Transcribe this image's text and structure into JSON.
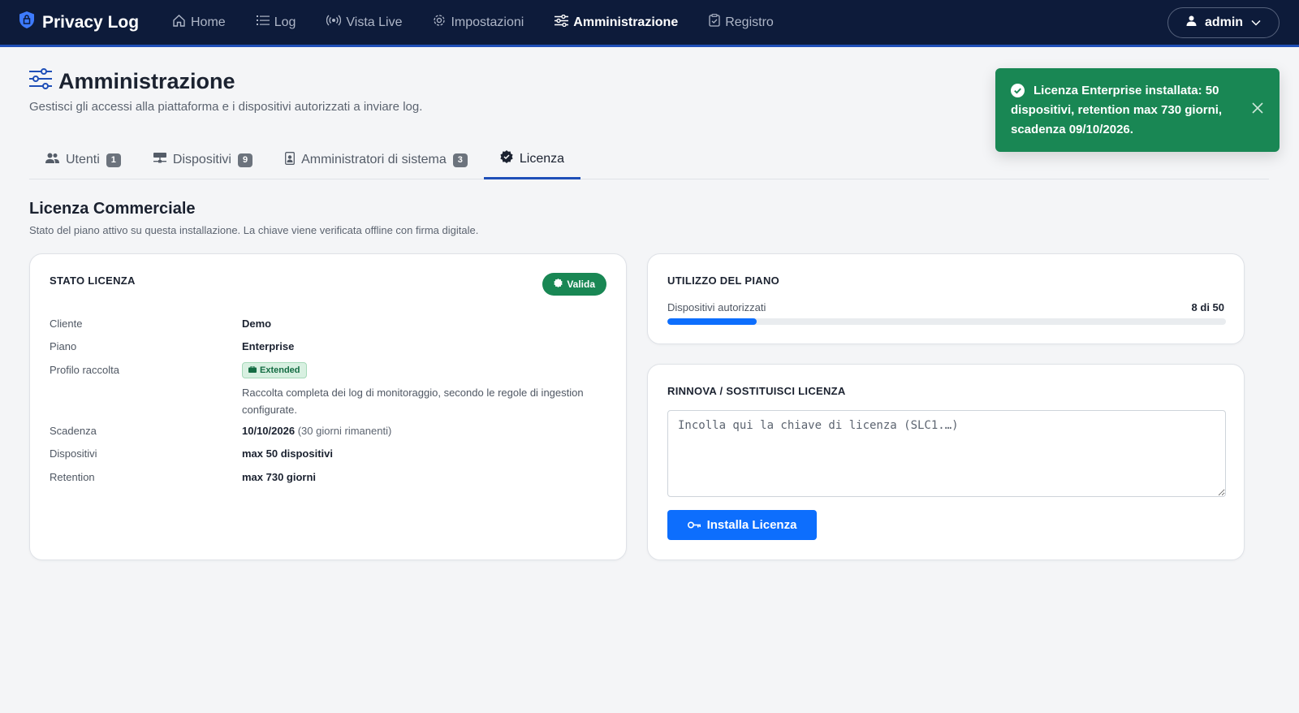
{
  "brand": {
    "name": "Privacy Log"
  },
  "nav": {
    "items": [
      {
        "label": "Home",
        "icon": "home-icon"
      },
      {
        "label": "Log",
        "icon": "list-icon"
      },
      {
        "label": "Vista Live",
        "icon": "broadcast-icon"
      },
      {
        "label": "Impostazioni",
        "icon": "gear-icon"
      },
      {
        "label": "Amministrazione",
        "icon": "sliders-icon",
        "active": true
      },
      {
        "label": "Registro",
        "icon": "clipboard-check-icon"
      }
    ],
    "user": "admin"
  },
  "page": {
    "title": "Amministrazione",
    "subtitle": "Gestisci gli accessi alla piattaforma e i dispositivi autorizzati a inviare log."
  },
  "tabs": [
    {
      "label": "Utenti",
      "count": "1",
      "icon": "people-icon"
    },
    {
      "label": "Dispositivi",
      "count": "9",
      "icon": "hdd-network-icon"
    },
    {
      "label": "Amministratori di sistema",
      "count": "3",
      "icon": "person-badge-icon"
    },
    {
      "label": "Licenza",
      "icon": "patch-check-icon",
      "active": true
    }
  ],
  "section": {
    "title": "Licenza Commerciale",
    "subtitle": "Stato del piano attivo su questa installazione. La chiave viene verificata offline con firma digitale."
  },
  "license_status": {
    "title": "STATO LICENZA",
    "badge": "Valida",
    "rows": {
      "cliente": {
        "label": "Cliente",
        "value": "Demo"
      },
      "piano": {
        "label": "Piano",
        "value": "Enterprise"
      },
      "profilo": {
        "label": "Profilo raccolta",
        "badge": "Extended",
        "description": "Raccolta completa dei log di monitoraggio, secondo le regole di ingestion configurate."
      },
      "scadenza": {
        "label": "Scadenza",
        "value": "10/10/2026",
        "note": "(30 giorni rimanenti)"
      },
      "dispositivi": {
        "label": "Dispositivi",
        "value": "max 50 dispositivi"
      },
      "retention": {
        "label": "Retention",
        "value": "max 730 giorni"
      }
    }
  },
  "usage": {
    "title": "UTILIZZO DEL PIANO",
    "label": "Dispositivi autorizzati",
    "value": "8 di 50",
    "used": 8,
    "max": 50
  },
  "renew": {
    "title": "RINNOVA / SOSTITUISCI LICENZA",
    "placeholder": "Incolla qui la chiave di licenza (SLC1.…)",
    "button": "Installa Licenza"
  },
  "toast": {
    "message": "Licenza Enterprise installata: 50 dispositivi, retention max 730 giorni, scadenza 09/10/2026."
  },
  "colors": {
    "navbar": "#0d1b3a",
    "accent": "#0d6efd",
    "success": "#198754"
  }
}
